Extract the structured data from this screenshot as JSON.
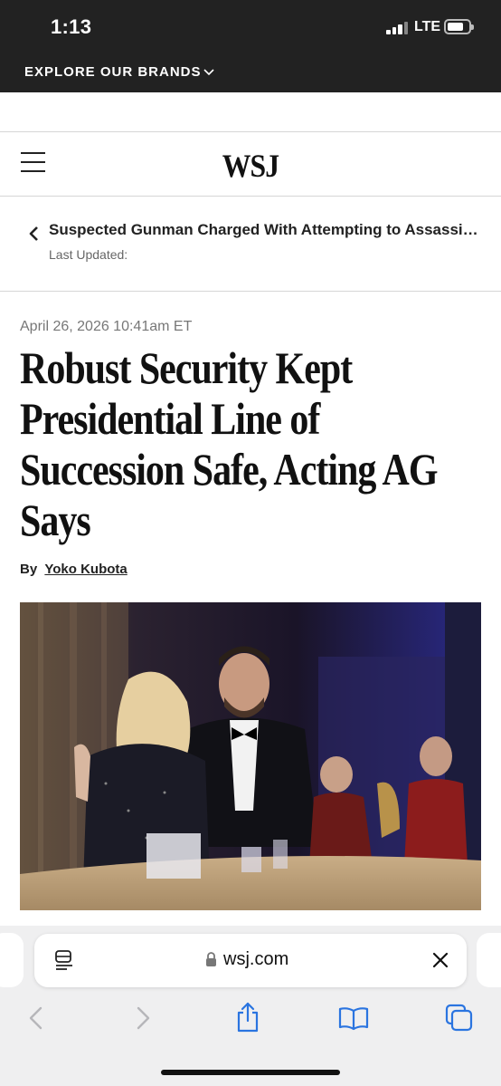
{
  "status": {
    "time": "1:13",
    "network": "LTE"
  },
  "brands_bar": {
    "label": "EXPLORE OUR BRANDS"
  },
  "masthead": {
    "logo": "WSJ"
  },
  "live_coverage": {
    "title": "Suspected Gunman Charged With Attempting to Assassinate",
    "updated_label": "Last Updated:"
  },
  "article": {
    "dateline": "April 26, 2026 10:41am ET",
    "headline": "Robust Security Kept Presidential Line of Succession Safe, Acting AG Says",
    "byline_prefix": "By",
    "author": "Yoko Kubota"
  },
  "browser": {
    "url": "wsj.com",
    "icons": [
      "reader-icon",
      "lock-icon",
      "close-icon",
      "back-icon",
      "forward-icon",
      "share-icon",
      "bookmarks-icon",
      "tabs-icon"
    ]
  },
  "colors": {
    "header_bg": "#222222",
    "ios_blue": "#2a74e0",
    "toolbar_bg": "#efeff0"
  }
}
